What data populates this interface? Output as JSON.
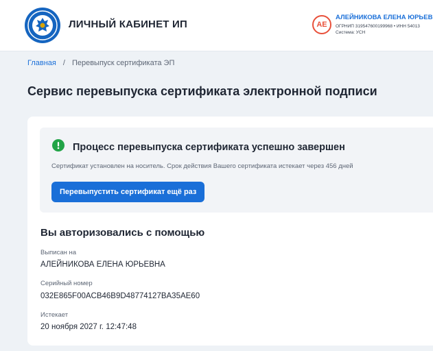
{
  "header": {
    "title": "ЛИЧНЫЙ КАБИНЕТ ИП",
    "logo_icon": "fns-emblem-icon",
    "user": {
      "initials": "АЕ",
      "name": "АЛЕЙНИКОВА ЕЛЕНА ЮРЬЕВНА",
      "ids": "ОГРНИП 319547600199968 • ИНН 54013",
      "system": "Система: УСН"
    }
  },
  "breadcrumb": {
    "home": "Главная",
    "separator": "/",
    "current": "Перевыпуск сертификата ЭП"
  },
  "page": {
    "title": "Сервис перевыпуска сертификата электронной подписи"
  },
  "success": {
    "icon": "exclamation-icon",
    "title": "Процесс перевыпуска сертификата успешно завершен",
    "description": "Сертификат установлен на носитель. Срок действия Вашего сертификата истекает через 456 дней",
    "button_label": "Перевыпустить сертификат ещё раз"
  },
  "auth": {
    "title": "Вы авторизовались с помощью",
    "fields": [
      {
        "label": "Выписан на",
        "value": "АЛЕЙНИКОВА ЕЛЕНА ЮРЬЕВНА"
      },
      {
        "label": "Серийный номер",
        "value": "032E865F00ACB46B9D48774127BA35AE60"
      },
      {
        "label": "Истекает",
        "value": "20 ноября 2027 г. 12:47:48"
      }
    ]
  },
  "colors": {
    "accent": "#1a6fd8",
    "success": "#22a447",
    "avatar": "#e8503a",
    "background": "#eef2f6"
  }
}
